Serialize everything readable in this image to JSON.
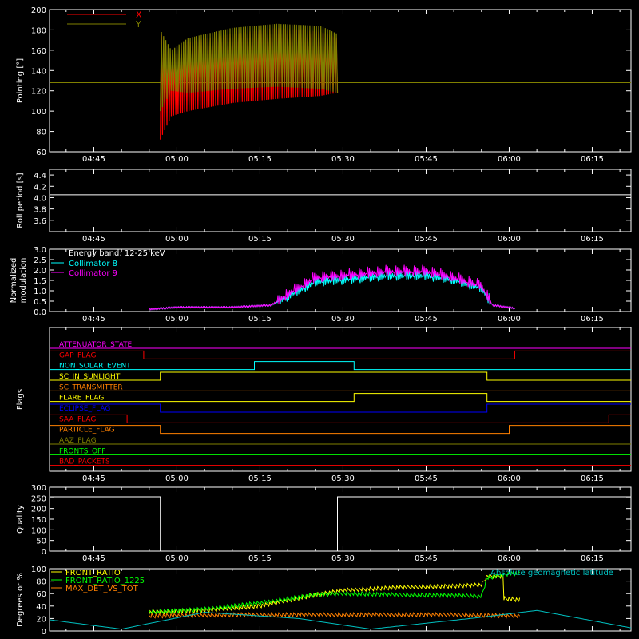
{
  "chart_data": [
    {
      "type": "line",
      "ylabel": "Pointing [°]",
      "ylim": [
        60,
        200
      ],
      "yticks": [
        60,
        80,
        100,
        120,
        140,
        160,
        180,
        200
      ],
      "xticks": [
        "04:45",
        "05:00",
        "05:15",
        "05:30",
        "05:45",
        "06:00",
        "06:15"
      ],
      "xlim": [
        "04:37",
        "06:22"
      ],
      "legend": "top-left",
      "series": [
        {
          "name": "X",
          "color": "#ff0000",
          "envelope_x": [
            "04:57",
            "04:59",
            "05:02",
            "05:10",
            "05:18",
            "05:26",
            "05:29"
          ],
          "min": [
            72,
            95,
            100,
            108,
            112,
            115,
            118
          ],
          "max": [
            178,
            150,
            168,
            176,
            182,
            178,
            172
          ],
          "period_s": 4.05
        },
        {
          "name": "Y",
          "color": "#808000",
          "envelope_x": [
            "04:57",
            "04:59",
            "05:02",
            "05:10",
            "05:18",
            "05:26",
            "05:29"
          ],
          "min": [
            100,
            120,
            118,
            122,
            124,
            122,
            118
          ],
          "max": [
            180,
            160,
            172,
            182,
            186,
            184,
            176
          ],
          "period_s": 4.05
        },
        {
          "name": "",
          "color": "#808000",
          "x": [
            "04:37",
            "06:22"
          ],
          "y": [
            128,
            128
          ]
        }
      ]
    },
    {
      "type": "line",
      "ylabel": "Roll period [s]",
      "ylim": [
        3.4,
        4.5
      ],
      "yticks": [
        "3.6",
        "3.8",
        "4.0",
        "4.2",
        "4.4"
      ],
      "xticks": [
        "04:45",
        "05:00",
        "05:15",
        "05:30",
        "05:45",
        "06:00",
        "06:15"
      ],
      "series": [
        {
          "color": "#ffffff",
          "x": [
            "04:37",
            "06:22"
          ],
          "y": [
            4.05,
            4.05
          ]
        }
      ]
    },
    {
      "type": "line",
      "ylabel": "Normalized modulation",
      "ylim": [
        0,
        3.0
      ],
      "yticks": [
        "0.0",
        "0.5",
        "1.0",
        "1.5",
        "2.0",
        "2.5",
        "3.0"
      ],
      "xticks": [
        "04:45",
        "05:00",
        "05:15",
        "05:30",
        "05:45",
        "06:00",
        "06:15"
      ],
      "annotation": "Energy band: 12-25 keV",
      "legend": "top-left",
      "series": [
        {
          "name": "Collimator 8",
          "color": "#00ffff",
          "x": [
            "04:55",
            "05:00",
            "05:10",
            "05:17",
            "05:20",
            "05:25",
            "05:30",
            "05:38",
            "05:45",
            "05:50",
            "05:55",
            "05:57",
            "06:01"
          ],
          "y": [
            0.1,
            0.2,
            0.2,
            0.3,
            0.7,
            1.4,
            1.5,
            1.7,
            1.7,
            1.5,
            1.1,
            0.3,
            0.15
          ]
        },
        {
          "name": "Collimator 9",
          "color": "#ff00ff",
          "x": [
            "04:55",
            "05:00",
            "05:10",
            "05:17",
            "05:20",
            "05:25",
            "05:30",
            "05:38",
            "05:45",
            "05:50",
            "05:55",
            "05:57",
            "06:01"
          ],
          "y": [
            0.1,
            0.2,
            0.2,
            0.3,
            0.8,
            1.6,
            1.7,
            1.9,
            1.9,
            1.6,
            1.2,
            0.3,
            0.15
          ]
        }
      ]
    },
    {
      "type": "line",
      "ylabel": "Flags",
      "xticks": [
        "04:45",
        "05:00",
        "05:15",
        "05:30",
        "05:45",
        "06:00",
        "06:15"
      ],
      "flags": [
        {
          "name": "ATTENUATOR_STATE",
          "color": "#ff00ff",
          "segments": [
            [
              "04:37",
              "06:22",
              0
            ]
          ]
        },
        {
          "name": "GAP_FLAG",
          "color": "#ff0000",
          "segments": [
            [
              "04:37",
              "04:54",
              1
            ],
            [
              "04:54",
              "06:01",
              0
            ],
            [
              "06:01",
              "06:22",
              1
            ]
          ]
        },
        {
          "name": "NON_SOLAR_EVENT",
          "color": "#00ffff",
          "segments": [
            [
              "04:37",
              "05:14",
              0
            ],
            [
              "05:14",
              "05:32",
              1
            ],
            [
              "05:32",
              "06:22",
              0
            ]
          ]
        },
        {
          "name": "SC_IN_SUNLIGHT",
          "color": "#ffff00",
          "segments": [
            [
              "04:37",
              "04:57",
              0
            ],
            [
              "04:57",
              "05:56",
              1
            ],
            [
              "05:56",
              "06:22",
              0
            ]
          ]
        },
        {
          "name": "SC_TRANSMITTER",
          "color": "#ff8000",
          "segments": [
            [
              "04:37",
              "06:22",
              0
            ]
          ]
        },
        {
          "name": "FLARE_FLAG",
          "color": "#ffff00",
          "segments": [
            [
              "04:37",
              "05:32",
              0
            ],
            [
              "05:32",
              "05:56",
              1
            ],
            [
              "05:56",
              "06:22",
              0
            ]
          ]
        },
        {
          "name": "ECLIPSE_FLAG",
          "color": "#0000ff",
          "segments": [
            [
              "04:37",
              "04:57",
              1
            ],
            [
              "04:57",
              "05:56",
              0
            ],
            [
              "05:56",
              "06:22",
              1
            ]
          ]
        },
        {
          "name": "SAA_FLAG",
          "color": "#ff0000",
          "segments": [
            [
              "04:37",
              "04:51",
              1
            ],
            [
              "04:51",
              "06:18",
              0
            ],
            [
              "06:18",
              "06:22",
              1
            ]
          ]
        },
        {
          "name": "PARTICLE_FLAG",
          "color": "#ff8000",
          "segments": [
            [
              "04:37",
              "04:57",
              1
            ],
            [
              "04:57",
              "06:00",
              0
            ],
            [
              "06:00",
              "06:22",
              1
            ]
          ]
        },
        {
          "name": "AAZ_FLAG",
          "color": "#808000",
          "segments": [
            [
              "04:37",
              "06:22",
              0
            ]
          ]
        },
        {
          "name": "FRONTS_OFF",
          "color": "#00ff00",
          "segments": [
            [
              "04:37",
              "06:22",
              0
            ]
          ]
        },
        {
          "name": "BAD_PACKETS",
          "color": "#ff0000",
          "segments": [
            [
              "04:37",
              "06:22",
              0
            ]
          ]
        }
      ]
    },
    {
      "type": "line",
      "ylabel": "Quality",
      "ylim": [
        0,
        300
      ],
      "yticks": [
        0,
        50,
        100,
        150,
        200,
        250,
        300
      ],
      "xticks": [
        "04:45",
        "05:00",
        "05:15",
        "05:30",
        "05:45",
        "06:00",
        "06:15"
      ],
      "series": [
        {
          "color": "#ffffff",
          "x": [
            "04:37",
            "04:57",
            "04:57",
            "05:29",
            "05:29",
            "06:22"
          ],
          "y": [
            255,
            255,
            0,
            0,
            255,
            255
          ]
        }
      ]
    },
    {
      "type": "line",
      "ylabel": "Degrees or %",
      "ylim": [
        0,
        100
      ],
      "yticks": [
        0,
        20,
        40,
        60,
        80,
        100
      ],
      "legend": "top-left",
      "series": [
        {
          "name": "FRONT_RATIO",
          "color": "#ffff00",
          "x": [
            "04:55",
            "05:05",
            "05:15",
            "05:25",
            "05:30",
            "05:40",
            "05:50",
            "05:55",
            "05:56",
            "05:59",
            "05:59",
            "06:02"
          ],
          "y": [
            30,
            33,
            40,
            58,
            65,
            70,
            72,
            74,
            88,
            88,
            52,
            50
          ]
        },
        {
          "name": "FRONT_RATIO_1225",
          "color": "#00ff00",
          "x": [
            "04:55",
            "05:05",
            "05:15",
            "05:25",
            "05:30",
            "05:40",
            "05:50",
            "05:55",
            "05:56",
            "05:59",
            "06:00",
            "06:02"
          ],
          "y": [
            30,
            35,
            45,
            58,
            60,
            58,
            57,
            56,
            85,
            90,
            92,
            92
          ]
        },
        {
          "name": "MAX_DET_VS_TOT",
          "color": "#ff8000",
          "x": [
            "04:55",
            "05:10",
            "05:30",
            "05:50",
            "06:02"
          ],
          "y": [
            24,
            26,
            26,
            26,
            24
          ]
        },
        {
          "name": "Absolute geomagnetic latitude",
          "color": "#00c0c0",
          "x": [
            "04:37",
            "04:50",
            "05:05",
            "05:22",
            "05:35",
            "05:55",
            "06:05",
            "06:22"
          ],
          "y": [
            18,
            3,
            30,
            20,
            3,
            22,
            33,
            5
          ]
        }
      ]
    }
  ]
}
